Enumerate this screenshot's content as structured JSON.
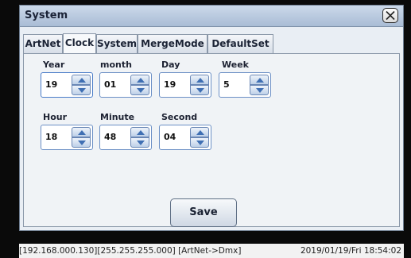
{
  "window": {
    "title": "System"
  },
  "tabs": [
    {
      "label": "ArtNet"
    },
    {
      "label": "Clock",
      "active": true
    },
    {
      "label": "System"
    },
    {
      "label": "MergeMode"
    },
    {
      "label": "DefaultSet"
    }
  ],
  "clock": {
    "year": {
      "label": "Year",
      "value": "19"
    },
    "month": {
      "label": "month",
      "value": "01"
    },
    "day": {
      "label": "Day",
      "value": "19"
    },
    "week": {
      "label": "Week",
      "value": "5"
    },
    "hour": {
      "label": "Hour",
      "value": "18"
    },
    "minute": {
      "label": "Minute",
      "value": "48"
    },
    "second": {
      "label": "Second",
      "value": "04"
    }
  },
  "save_label": "Save",
  "status": {
    "network": "[192.168.000.130][255.255.255.000] [ArtNet->Dmx]",
    "datetime": "2019/01/19/Fri  18:54:02"
  },
  "icons": {
    "close": "close-x-icon",
    "up": "spin-up-arrow-icon",
    "down": "spin-down-arrow-icon"
  },
  "colors": {
    "titlebar": "#b7c8dd",
    "spinner_border": "#6b8fc5",
    "panel_bg": "#f0f3f6"
  }
}
